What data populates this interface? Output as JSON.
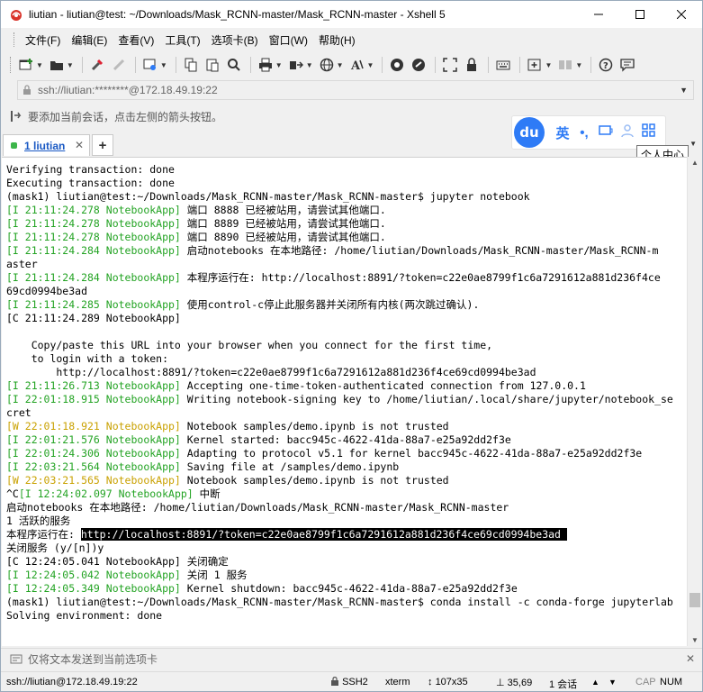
{
  "window": {
    "title": "liutian - liutian@test: ~/Downloads/Mask_RCNN-master/Mask_RCNN-master - Xshell 5"
  },
  "menu": {
    "items": [
      "文件(F)",
      "编辑(E)",
      "查看(V)",
      "工具(T)",
      "选项卡(B)",
      "窗口(W)",
      "帮助(H)"
    ]
  },
  "toolbar": {
    "icons": [
      "new-session-icon",
      "open-folder-icon",
      "reconnect-icon",
      "disconnect-icon",
      "properties-icon",
      "copy-icon",
      "paste-icon",
      "find-icon",
      "print-icon",
      "transfer-icon",
      "globe-icon",
      "font-icon",
      "xftp-icon",
      "xmanager-icon",
      "fullscreen-icon",
      "lock-icon",
      "keyboard-icon",
      "new-tab-icon",
      "layout-icon",
      "help-icon",
      "chat-icon"
    ]
  },
  "address": {
    "value": "ssh://liutian:********@172.18.49.19:22"
  },
  "hint": {
    "text": "要添加当前会话，点击左侧的箭头按钮。"
  },
  "ime": {
    "logo": "du",
    "items": [
      "英",
      "•,",
      "⌨",
      "👤",
      "▦"
    ],
    "tooltip": "个人中心"
  },
  "tabs": [
    {
      "label": "1 liutian",
      "active": true
    }
  ],
  "terminal": {
    "lines": [
      [
        {
          "t": "Verifying transaction: done",
          "c": ""
        }
      ],
      [
        {
          "t": "Executing transaction: done",
          "c": ""
        }
      ],
      [
        {
          "t": "(mask1) liutian@test:~/Downloads/Mask_RCNN-master/Mask_RCNN-master$ jupyter notebook",
          "c": ""
        }
      ],
      [
        {
          "t": "[I 21:11:24.278 NotebookApp]",
          "c": "g"
        },
        {
          "t": " 端口 8888 已经被站用，请尝试其他端口.",
          "c": ""
        }
      ],
      [
        {
          "t": "[I 21:11:24.278 NotebookApp]",
          "c": "g"
        },
        {
          "t": " 端口 8889 已经被站用，请尝试其他端口.",
          "c": ""
        }
      ],
      [
        {
          "t": "[I 21:11:24.278 NotebookApp]",
          "c": "g"
        },
        {
          "t": " 端口 8890 已经被站用，请尝试其他端口.",
          "c": ""
        }
      ],
      [
        {
          "t": "[I 21:11:24.284 NotebookApp]",
          "c": "g"
        },
        {
          "t": " 启动notebooks 在本地路径: /home/liutian/Downloads/Mask_RCNN-master/Mask_RCNN-m",
          "c": ""
        }
      ],
      [
        {
          "t": "aster",
          "c": ""
        }
      ],
      [
        {
          "t": "[I 21:11:24.284 NotebookApp]",
          "c": "g"
        },
        {
          "t": " 本程序运行在: http://localhost:8891/?token=c22e0ae8799f1c6a7291612a881d236f4ce",
          "c": ""
        }
      ],
      [
        {
          "t": "69cd0994be3ad",
          "c": ""
        }
      ],
      [
        {
          "t": "[I 21:11:24.285 NotebookApp]",
          "c": "g"
        },
        {
          "t": " 使用control-c停止此服务器并关闭所有内核(两次跳过确认).",
          "c": ""
        }
      ],
      [
        {
          "t": "[C 21:11:24.289 NotebookApp]",
          "c": ""
        }
      ],
      [
        {
          "t": " ",
          "c": ""
        }
      ],
      [
        {
          "t": "    Copy/paste this URL into your browser when you connect for the first time,",
          "c": ""
        }
      ],
      [
        {
          "t": "    to login with a token:",
          "c": ""
        }
      ],
      [
        {
          "t": "        http://localhost:8891/?token=c22e0ae8799f1c6a7291612a881d236f4ce69cd0994be3ad",
          "c": ""
        }
      ],
      [
        {
          "t": "[I 21:11:26.713 NotebookApp]",
          "c": "g"
        },
        {
          "t": " Accepting one-time-token-authenticated connection from 127.0.0.1",
          "c": ""
        }
      ],
      [
        {
          "t": "[I 22:01:18.915 NotebookApp]",
          "c": "g"
        },
        {
          "t": " Writing notebook-signing key to /home/liutian/.local/share/jupyter/notebook_se",
          "c": ""
        }
      ],
      [
        {
          "t": "cret",
          "c": ""
        }
      ],
      [
        {
          "t": "[W 22:01:18.921 NotebookApp]",
          "c": "y"
        },
        {
          "t": " Notebook samples/demo.ipynb is not trusted",
          "c": ""
        }
      ],
      [
        {
          "t": "[I 22:01:21.576 NotebookApp]",
          "c": "g"
        },
        {
          "t": " Kernel started: bacc945c-4622-41da-88a7-e25a92dd2f3e",
          "c": ""
        }
      ],
      [
        {
          "t": "[I 22:01:24.306 NotebookApp]",
          "c": "g"
        },
        {
          "t": " Adapting to protocol v5.1 for kernel bacc945c-4622-41da-88a7-e25a92dd2f3e",
          "c": ""
        }
      ],
      [
        {
          "t": "[I 22:03:21.564 NotebookApp]",
          "c": "g"
        },
        {
          "t": " Saving file at /samples/demo.ipynb",
          "c": ""
        }
      ],
      [
        {
          "t": "[W 22:03:21.565 NotebookApp]",
          "c": "y"
        },
        {
          "t": " Notebook samples/demo.ipynb is not trusted",
          "c": ""
        }
      ],
      [
        {
          "t": "^C",
          "c": ""
        },
        {
          "t": "[I 12:24:02.097 NotebookApp]",
          "c": "g"
        },
        {
          "t": " 中断",
          "c": ""
        }
      ],
      [
        {
          "t": "启动notebooks 在本地路径: /home/liutian/Downloads/Mask_RCNN-master/Mask_RCNN-master",
          "c": ""
        }
      ],
      [
        {
          "t": "1 活跃的服务",
          "c": ""
        }
      ],
      [
        {
          "t": "本程序运行在: ",
          "c": ""
        },
        {
          "t": "http://localhost:8891/?token=c22e0ae8799f1c6a7291612a881d236f4ce69cd0994be3ad ",
          "c": "hl"
        }
      ],
      [
        {
          "t": "关闭服务 (y/[n])y",
          "c": ""
        }
      ],
      [
        {
          "t": "[C 12:24:05.041 NotebookApp]",
          "c": ""
        },
        {
          "t": " 关闭确定",
          "c": ""
        }
      ],
      [
        {
          "t": "[I 12:24:05.042 NotebookApp]",
          "c": "g"
        },
        {
          "t": " 关闭 1 服务",
          "c": ""
        }
      ],
      [
        {
          "t": "[I 12:24:05.349 NotebookApp]",
          "c": "g"
        },
        {
          "t": " Kernel shutdown: bacc945c-4622-41da-88a7-e25a92dd2f3e",
          "c": ""
        }
      ],
      [
        {
          "t": "(mask1) liutian@test:~/Downloads/Mask_RCNN-master/Mask_RCNN-master$ conda install -c conda-forge jupyterlab",
          "c": ""
        }
      ],
      [
        {
          "t": "Solving environment: done",
          "c": ""
        }
      ]
    ]
  },
  "compose": {
    "text": "仅将文本发送到当前选项卡"
  },
  "status": {
    "connection": "ssh://liutian@172.18.49.19:22",
    "protocol": "SSH2",
    "terminal_type": "xterm",
    "size": "107x35",
    "cursor": "35,69",
    "sessions": "1 会话",
    "cap": "CAP",
    "num": "NUM"
  },
  "colors": {
    "green_log": "#23a323",
    "yellow_log": "#c9a100",
    "accent": "#2e7bf6"
  }
}
